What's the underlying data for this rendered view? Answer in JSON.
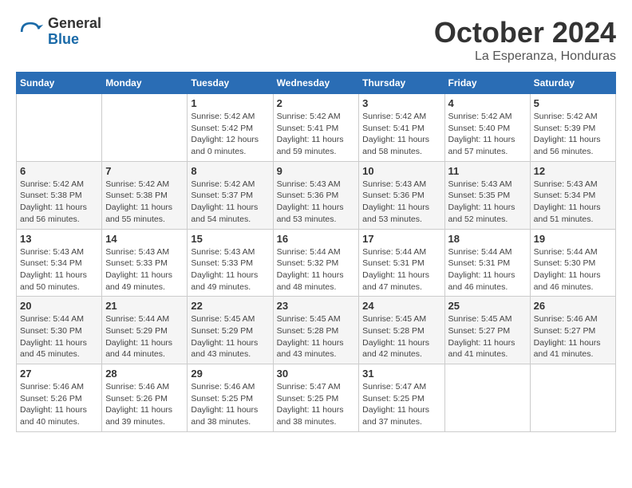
{
  "header": {
    "logo_general": "General",
    "logo_blue": "Blue",
    "title": "October 2024",
    "subtitle": "La Esperanza, Honduras"
  },
  "calendar": {
    "days_of_week": [
      "Sunday",
      "Monday",
      "Tuesday",
      "Wednesday",
      "Thursday",
      "Friday",
      "Saturday"
    ],
    "weeks": [
      [
        {
          "day": null,
          "info": null
        },
        {
          "day": null,
          "info": null
        },
        {
          "day": "1",
          "info": "Sunrise: 5:42 AM\nSunset: 5:42 PM\nDaylight: 12 hours\nand 0 minutes."
        },
        {
          "day": "2",
          "info": "Sunrise: 5:42 AM\nSunset: 5:41 PM\nDaylight: 11 hours\nand 59 minutes."
        },
        {
          "day": "3",
          "info": "Sunrise: 5:42 AM\nSunset: 5:41 PM\nDaylight: 11 hours\nand 58 minutes."
        },
        {
          "day": "4",
          "info": "Sunrise: 5:42 AM\nSunset: 5:40 PM\nDaylight: 11 hours\nand 57 minutes."
        },
        {
          "day": "5",
          "info": "Sunrise: 5:42 AM\nSunset: 5:39 PM\nDaylight: 11 hours\nand 56 minutes."
        }
      ],
      [
        {
          "day": "6",
          "info": "Sunrise: 5:42 AM\nSunset: 5:38 PM\nDaylight: 11 hours\nand 56 minutes."
        },
        {
          "day": "7",
          "info": "Sunrise: 5:42 AM\nSunset: 5:38 PM\nDaylight: 11 hours\nand 55 minutes."
        },
        {
          "day": "8",
          "info": "Sunrise: 5:42 AM\nSunset: 5:37 PM\nDaylight: 11 hours\nand 54 minutes."
        },
        {
          "day": "9",
          "info": "Sunrise: 5:43 AM\nSunset: 5:36 PM\nDaylight: 11 hours\nand 53 minutes."
        },
        {
          "day": "10",
          "info": "Sunrise: 5:43 AM\nSunset: 5:36 PM\nDaylight: 11 hours\nand 53 minutes."
        },
        {
          "day": "11",
          "info": "Sunrise: 5:43 AM\nSunset: 5:35 PM\nDaylight: 11 hours\nand 52 minutes."
        },
        {
          "day": "12",
          "info": "Sunrise: 5:43 AM\nSunset: 5:34 PM\nDaylight: 11 hours\nand 51 minutes."
        }
      ],
      [
        {
          "day": "13",
          "info": "Sunrise: 5:43 AM\nSunset: 5:34 PM\nDaylight: 11 hours\nand 50 minutes."
        },
        {
          "day": "14",
          "info": "Sunrise: 5:43 AM\nSunset: 5:33 PM\nDaylight: 11 hours\nand 49 minutes."
        },
        {
          "day": "15",
          "info": "Sunrise: 5:43 AM\nSunset: 5:33 PM\nDaylight: 11 hours\nand 49 minutes."
        },
        {
          "day": "16",
          "info": "Sunrise: 5:44 AM\nSunset: 5:32 PM\nDaylight: 11 hours\nand 48 minutes."
        },
        {
          "day": "17",
          "info": "Sunrise: 5:44 AM\nSunset: 5:31 PM\nDaylight: 11 hours\nand 47 minutes."
        },
        {
          "day": "18",
          "info": "Sunrise: 5:44 AM\nSunset: 5:31 PM\nDaylight: 11 hours\nand 46 minutes."
        },
        {
          "day": "19",
          "info": "Sunrise: 5:44 AM\nSunset: 5:30 PM\nDaylight: 11 hours\nand 46 minutes."
        }
      ],
      [
        {
          "day": "20",
          "info": "Sunrise: 5:44 AM\nSunset: 5:30 PM\nDaylight: 11 hours\nand 45 minutes."
        },
        {
          "day": "21",
          "info": "Sunrise: 5:44 AM\nSunset: 5:29 PM\nDaylight: 11 hours\nand 44 minutes."
        },
        {
          "day": "22",
          "info": "Sunrise: 5:45 AM\nSunset: 5:29 PM\nDaylight: 11 hours\nand 43 minutes."
        },
        {
          "day": "23",
          "info": "Sunrise: 5:45 AM\nSunset: 5:28 PM\nDaylight: 11 hours\nand 43 minutes."
        },
        {
          "day": "24",
          "info": "Sunrise: 5:45 AM\nSunset: 5:28 PM\nDaylight: 11 hours\nand 42 minutes."
        },
        {
          "day": "25",
          "info": "Sunrise: 5:45 AM\nSunset: 5:27 PM\nDaylight: 11 hours\nand 41 minutes."
        },
        {
          "day": "26",
          "info": "Sunrise: 5:46 AM\nSunset: 5:27 PM\nDaylight: 11 hours\nand 41 minutes."
        }
      ],
      [
        {
          "day": "27",
          "info": "Sunrise: 5:46 AM\nSunset: 5:26 PM\nDaylight: 11 hours\nand 40 minutes."
        },
        {
          "day": "28",
          "info": "Sunrise: 5:46 AM\nSunset: 5:26 PM\nDaylight: 11 hours\nand 39 minutes."
        },
        {
          "day": "29",
          "info": "Sunrise: 5:46 AM\nSunset: 5:25 PM\nDaylight: 11 hours\nand 38 minutes."
        },
        {
          "day": "30",
          "info": "Sunrise: 5:47 AM\nSunset: 5:25 PM\nDaylight: 11 hours\nand 38 minutes."
        },
        {
          "day": "31",
          "info": "Sunrise: 5:47 AM\nSunset: 5:25 PM\nDaylight: 11 hours\nand 37 minutes."
        },
        {
          "day": null,
          "info": null
        },
        {
          "day": null,
          "info": null
        }
      ]
    ]
  }
}
